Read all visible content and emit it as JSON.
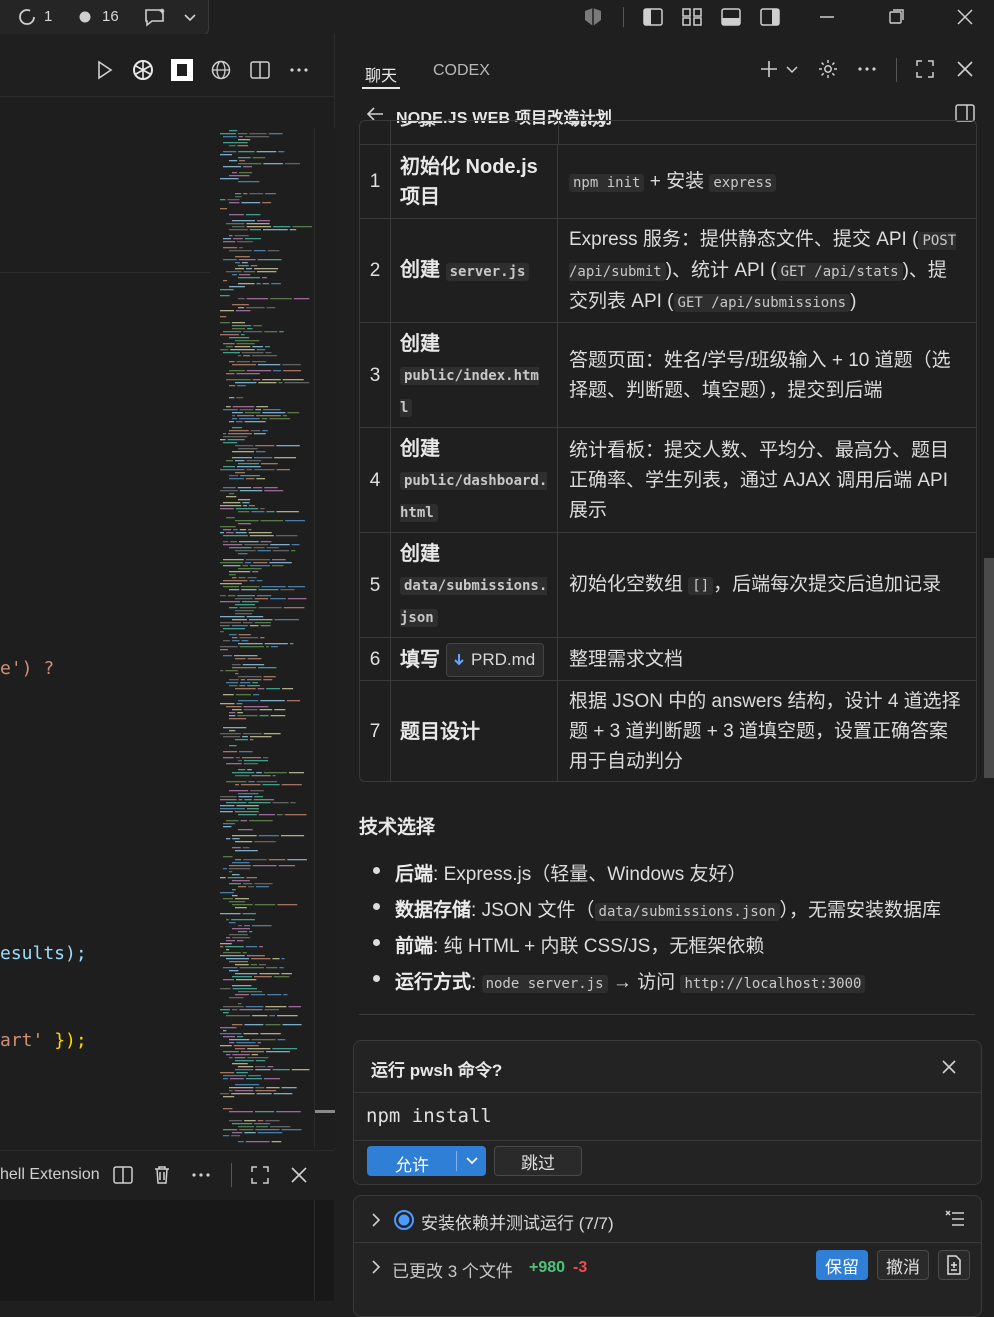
{
  "titlebar": {
    "sync_count": "1",
    "changes_count": "16"
  },
  "editor": {
    "code_line_1": "e') ?",
    "code_line_2": "esults);",
    "code_line_3_a": "art'",
    "code_line_3_b": " });",
    "panel_title": "hell Extension"
  },
  "chat": {
    "tabs": [
      "聊天",
      "CODEX"
    ],
    "title": "NODE.JS WEB 项目改造计划",
    "header_partial": "步骤",
    "header_partial_2": "说明",
    "rows": [
      {
        "num": "1",
        "step": "初始化 Node.js 项目",
        "desc_a": "npm init",
        "desc_b": " + 安装 ",
        "desc_c": "express"
      },
      {
        "num": "2",
        "step_a": "创建 ",
        "step_code": "server.js",
        "desc_a": "Express 服务：提供静态文件、提交 API (",
        "desc_b": "POST /api/submit",
        "desc_c": ")、统计 API (",
        "desc_d": "GET /api/stats",
        "desc_e": ")、提交列表 API (",
        "desc_f": "GET /api/submissions",
        "desc_g": ")"
      },
      {
        "num": "3",
        "step_a": "创建",
        "step_code": "public/index.html",
        "desc": "答题页面：姓名/学号/班级输入 + 10 道题（选择题、判断题、填空题），提交到后端"
      },
      {
        "num": "4",
        "step_a": "创建",
        "step_code": "public/dashboard.html",
        "desc": "统计看板：提交人数、平均分、最高分、题目正确率、学生列表，通过 AJAX 调用后端 API 展示"
      },
      {
        "num": "5",
        "step_a": "创建",
        "step_code": "data/submissions.json",
        "desc_a": "初始化空数组 ",
        "desc_b": "[]",
        "desc_c": "，后端每次提交后追加记录"
      },
      {
        "num": "6",
        "step_a": "填写",
        "step_file": "PRD.md",
        "desc": "整理需求文档"
      },
      {
        "num": "7",
        "step": "题目设计",
        "desc": "根据 JSON 中的 answers 结构，设计 4 道选择题 + 3 道判断题 + 3 道填空题，设置正确答案用于自动判分"
      }
    ],
    "tech_heading": "技术选择",
    "tech": [
      {
        "label": "后端",
        "text": ": Express.js（轻量、Windows 友好）"
      },
      {
        "label": "数据存储",
        "text_a": ": JSON 文件（",
        "code": "data/submissions.json",
        "text_b": "），无需安装数据库"
      },
      {
        "label": "前端",
        "text": ": 纯 HTML + 内联 CSS/JS，无框架依赖"
      },
      {
        "label": "运行方式",
        "text_a": ": ",
        "code": "node server.js",
        "text_b": " → 访问 ",
        "code2": "http://localhost:3000"
      }
    ],
    "confirm": {
      "title": "运行 pwsh 命令?",
      "command": "npm install",
      "allow_label": "允许",
      "skip_label": "跳过"
    },
    "tasks": {
      "todo_label": "安装依赖并测试运行 (7/7)",
      "changed_label": "已更改 3 个文件",
      "added": "+980",
      "removed": "-3",
      "keep_label": "保留",
      "undo_label": "撤消"
    }
  },
  "colors": {
    "accent": "#2f7fd6",
    "added": "#4ec27a",
    "removed": "#f14c4c"
  }
}
